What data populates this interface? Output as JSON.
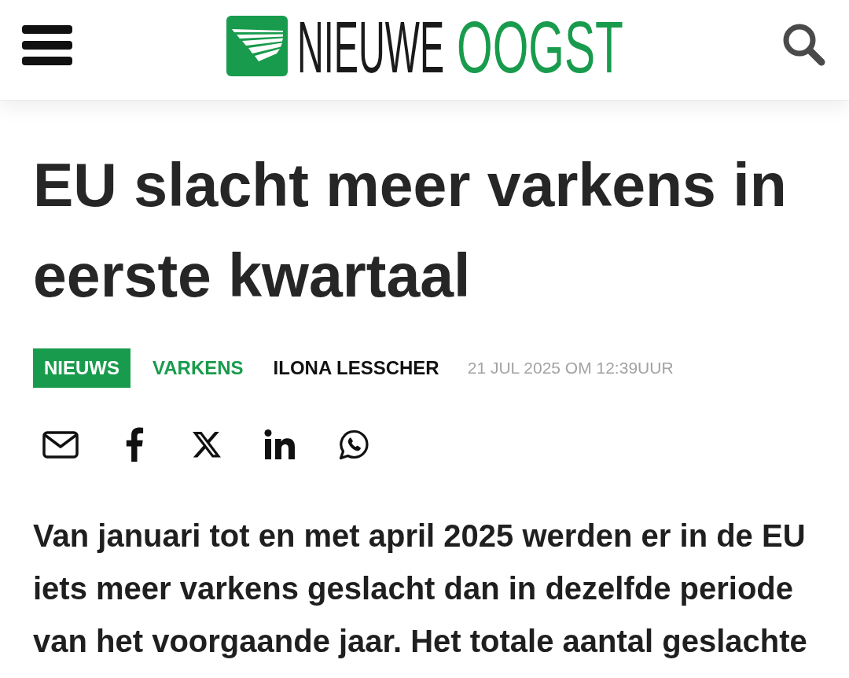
{
  "header": {
    "logo": {
      "text": "NIEUWE",
      "highlight": "OOGST"
    }
  },
  "article": {
    "title": "EU slacht meer varkens in eerste kwartaal",
    "meta": {
      "section": "NIEUWS",
      "category": "VARKENS",
      "author": "ILONA LESSCHER",
      "date": "21 JUL 2025 OM 12:39UUR"
    },
    "lead": "Van januari tot en met april 2025 werden er in de EU iets meer varkens geslacht dan in dezelfde periode van het voorgaande jaar. Het totale aantal geslachte"
  }
}
